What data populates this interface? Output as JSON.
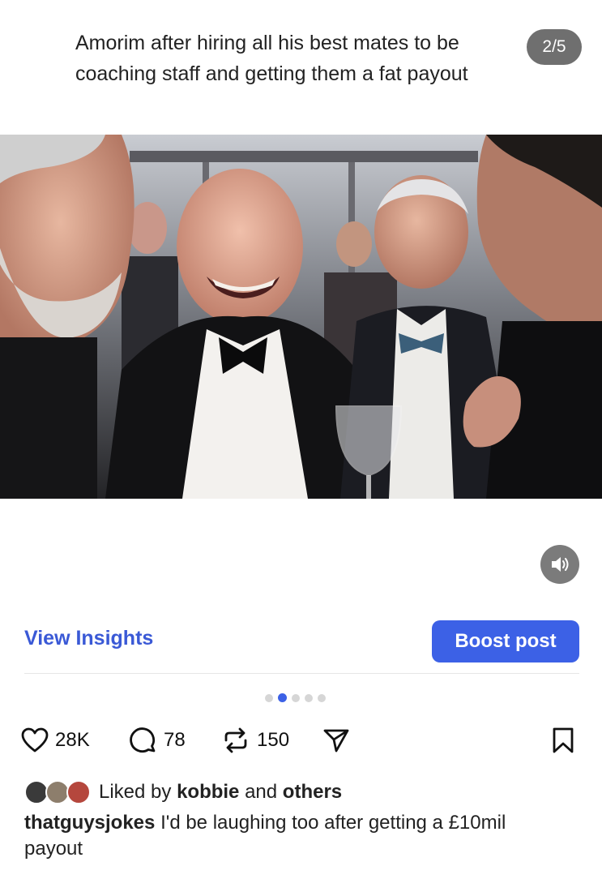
{
  "post": {
    "caption": "Amorim after hiring all his best mates to be coaching staff and getting them a fat payout",
    "counter": "2/5"
  },
  "media": {
    "description_icon": "sound-on-icon"
  },
  "insights": {
    "view_label": "View Insights",
    "boost_label": "Boost post"
  },
  "carousel": {
    "total": 5,
    "active_index": 1
  },
  "actions": {
    "likes": "28K",
    "comments": "78",
    "reposts": "150"
  },
  "likes_line": {
    "prefix": "Liked by",
    "user": "kobbie",
    "mid": "and",
    "others": "others"
  },
  "comment": {
    "username": "thatguysjokes",
    "text": "I'd be laughing too after getting a £10mil payout"
  },
  "colors": {
    "accent": "#3c61e6",
    "link": "#3a59d6",
    "counter_bg": "#6f6f6f"
  }
}
